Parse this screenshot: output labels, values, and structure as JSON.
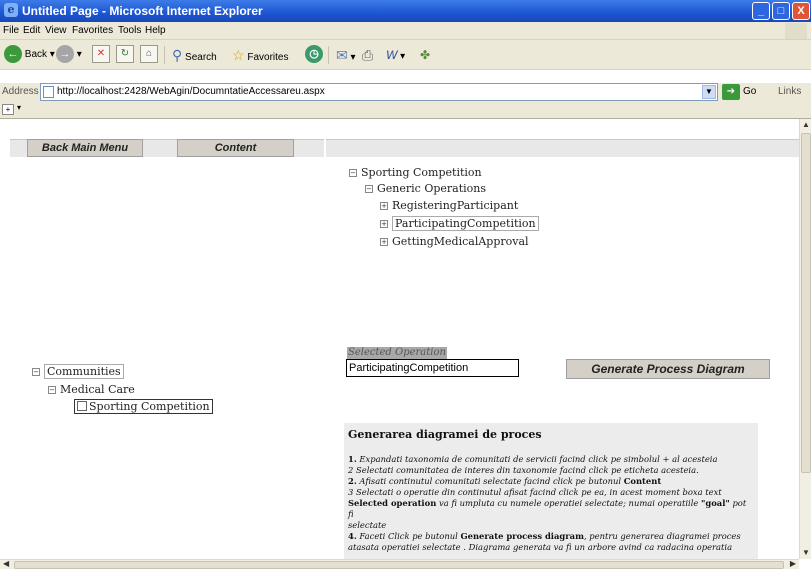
{
  "window": {
    "title": "Untitled Page - Microsoft Internet Explorer",
    "buttons": {
      "minimize": "_",
      "maximize": "□",
      "close": "X"
    }
  },
  "menu": [
    "File",
    "Edit",
    "View",
    "Favorites",
    "Tools",
    "Help"
  ],
  "toolbar": {
    "back": "Back",
    "search": "Search",
    "favorites": "Favorites"
  },
  "address": {
    "label": "Address",
    "url": "http://localhost:2428/WebAgin/DocumntatieAccessareu.aspx",
    "go": "Go",
    "links": "Links"
  },
  "page": {
    "back_button": "Back Main Menu",
    "content_button": "Content",
    "left_tree": {
      "root": "Communities",
      "child": "Medical Care",
      "leaf": "Sporting Competition"
    },
    "right_tree": {
      "root": "Sporting Competition",
      "group": "Generic Operations",
      "items": [
        "RegisteringParticipant",
        "ParticipatingCompetition",
        "GettingMedicalApproval"
      ]
    },
    "selected_operation_label": "Selected Operation",
    "selected_operation_value": "ParticipatingCompetition",
    "generate_button": "Generate  Process Diagram",
    "help": {
      "title": "Generarea diagramei de proces",
      "lines": [
        {
          "num": "1.",
          "text": " Expandati  taxonomia de comunitati de servicii facind click pe simbolul + al  acesteia"
        },
        {
          "num": "2",
          "text": " Selectati  comunitatea de interes  din taxonomie facind click pe  eticheta acesteia."
        },
        {
          "num": "2.",
          "text": " Afisati continutul comunitati selectate facind click pe butonul ",
          "bold": "Content"
        },
        {
          "num": "3",
          "text": " Selectati o operatie din continutul  afisat facind  click pe ea, in acest moment  boxa text"
        },
        {
          "num": "",
          "bold": "Selected operation",
          "text": " va fi umpluta cu numele operatiei selectate; numai operatiile ",
          "bold2": "\"goal\"",
          "text2": " pot fi"
        },
        {
          "num": "",
          "text": "selectate"
        },
        {
          "num": "4.",
          "text": " Faceti Click pe butonul ",
          "bold": "Generate process diagram",
          "text2": ",  pentru generarea  diagramei proces"
        },
        {
          "num": "",
          "text": "atasata operatiei selectate . Diagrama generata va fi un arbore avind ca radacina operatia"
        }
      ]
    }
  }
}
